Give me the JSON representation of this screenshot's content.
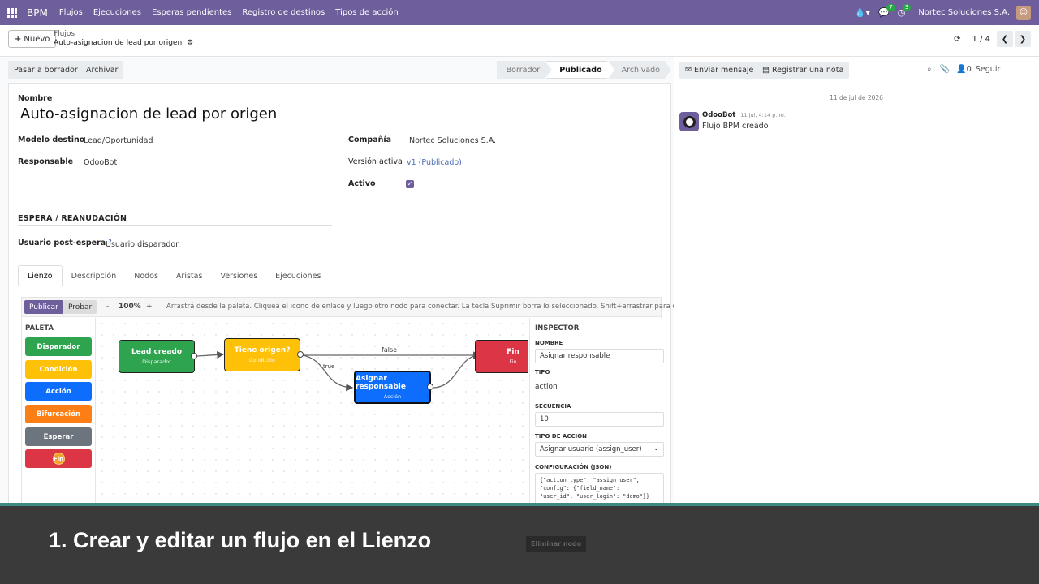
{
  "navbar": {
    "brand": "BPM",
    "items": [
      "Flujos",
      "Ejecuciones",
      "Esperas pendientes",
      "Registro de destinos",
      "Tipos de acción"
    ],
    "messages_count": "7",
    "activities_count": "3",
    "company": "Nortec Soluciones S.A.",
    "accent": "#6e5e9b"
  },
  "control": {
    "new_label": "Nuevo",
    "breadcrumb_parent": "Flujos",
    "breadcrumb_current": "Auto-asignacion de lead por origen",
    "pager": "1 / 4"
  },
  "statusbar": {
    "draft_btn": "Pasar a borrador",
    "archive_btn": "Archivar",
    "stages": [
      "Borrador",
      "Publicado",
      "Archivado"
    ],
    "active_stage": "Publicado"
  },
  "form": {
    "name_label": "Nombre",
    "name_value": "Auto-asignacion de lead por origen",
    "model_label": "Modelo destino",
    "model_value": "Lead/Oportunidad",
    "owner_label": "Responsable",
    "owner_value": "OdooBot",
    "company_label": "Compañía",
    "company_value": "Nortec Soluciones S.A.",
    "version_label": "Versión activa",
    "version_value": "v1 (Publicado)",
    "active_label": "Activo",
    "active_value": true,
    "section_title": "ESPERA / REANUDACIÓN",
    "post_wait_label": "Usuario post-espera",
    "post_wait_help": "?",
    "post_wait_value": "Usuario disparador"
  },
  "tabs": [
    "Lienzo",
    "Descripción",
    "Nodos",
    "Aristas",
    "Versiones",
    "Ejecuciones"
  ],
  "editor": {
    "publish_btn": "Publicar",
    "test_btn": "Probar",
    "zoom_out": "-",
    "zoom": "100%",
    "zoom_in": "+",
    "hint": "Arrastrá desde la paleta. Cliqueá el icono de enlace y luego otro nodo para conectar. La tecla Suprimir borra lo seleccionado. Shift+arrastrar para desplazar.",
    "palette_title": "PALETA",
    "palette": [
      {
        "label": "Disparador",
        "color": "#2ea44f"
      },
      {
        "label": "Condición",
        "color": "#ffc107"
      },
      {
        "label": "Acción",
        "color": "#0d6efd"
      },
      {
        "label": "Bifurcación",
        "color": "#fd7e14"
      },
      {
        "label": "Esperar",
        "color": "#6c757d"
      },
      {
        "label": "Fin",
        "color": "#dc3545"
      }
    ],
    "nodes": {
      "trigger": {
        "title": "Lead creado",
        "sub": "Disparador",
        "color": "#2ea44f"
      },
      "condition": {
        "title": "Tiene origen?",
        "sub": "Condición",
        "color": "#ffc107"
      },
      "action": {
        "title": "Asignar responsable",
        "sub": "Acción",
        "color": "#0d6efd"
      },
      "end": {
        "title": "Fin",
        "sub": "Fin",
        "color": "#dc3545"
      }
    },
    "edge_false": "false",
    "edge_true": "true"
  },
  "inspector": {
    "title": "INSPECTOR",
    "name_label": "NOMBRE",
    "name_value": "Asignar responsable",
    "type_label": "TIPO",
    "type_value": "action",
    "seq_label": "SECUENCIA",
    "seq_value": "10",
    "action_type_label": "TIPO DE ACCIÓN",
    "action_type_value": "Asignar usuario (assign_user)",
    "config_label": "CONFIGURACIÓN (JSON)",
    "config_value": "{\"action_type\": \"assign_user\",\n\"config\": {\"field_name\":\n\"user_id\", \"user_login\": \"demo\"}}",
    "delete_btn": "Eliminar nodo"
  },
  "chatter": {
    "send_btn": "Enviar mensaje",
    "note_btn": "Registrar una nota",
    "follow": "Seguir",
    "date": "11 de jul de 2026",
    "author": "OdooBot",
    "time": "11 jul, 4:14 p. m.",
    "body": "Flujo BPM creado"
  },
  "caption": "1. Crear y editar un flujo en el Lienzo"
}
